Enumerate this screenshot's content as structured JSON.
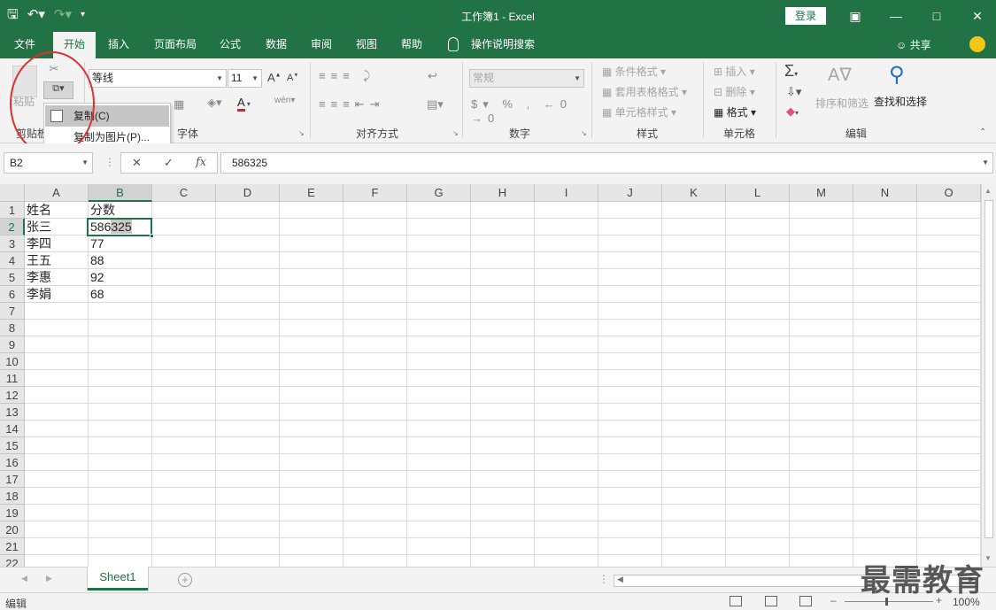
{
  "titlebar": {
    "title": "工作簿1  -  Excel",
    "login_label": "登录",
    "icons": [
      "save-icon",
      "undo-icon",
      "redo-icon",
      "customize-qat-icon",
      "ribbon-display-icon",
      "minimize-icon",
      "maximize-icon",
      "close-icon"
    ]
  },
  "tabs": {
    "items": [
      "文件",
      "开始",
      "插入",
      "页面布局",
      "公式",
      "数据",
      "审阅",
      "视图",
      "帮助"
    ],
    "active": "开始",
    "tell_me": "操作说明搜索",
    "share": "共享"
  },
  "ribbon": {
    "clipboard": {
      "label": "剪贴板",
      "paste": "粘贴"
    },
    "font": {
      "label": "字体",
      "font_name": "等线",
      "font_size": "11"
    },
    "alignment": {
      "label": "对齐方式"
    },
    "number": {
      "label": "数字",
      "format": "常规"
    },
    "styles": {
      "label": "样式",
      "conditional": "条件格式",
      "table": "套用表格格式",
      "cell_styles": "单元格样式"
    },
    "cells": {
      "label": "单元格",
      "insert": "插入",
      "delete": "删除",
      "format": "格式"
    },
    "editing": {
      "label": "编辑",
      "sort_filter": "排序和筛选",
      "find_select": "查找和选择"
    }
  },
  "copy_menu": {
    "items": [
      "复制(C)",
      "复制为图片(P)..."
    ],
    "highlighted": 0
  },
  "formula_bar": {
    "name_box": "B2",
    "value": "586325"
  },
  "sheet": {
    "columns": [
      "A",
      "B",
      "C",
      "D",
      "E",
      "F",
      "G",
      "H",
      "I",
      "J",
      "K",
      "L",
      "M",
      "N",
      "O"
    ],
    "selected_column": "B",
    "selected_row": 2,
    "rows": [
      {
        "num": "1",
        "A": "姓名",
        "B": "分数"
      },
      {
        "num": "2",
        "A": "张三",
        "B": "586325"
      },
      {
        "num": "3",
        "A": "李四",
        "B": "77"
      },
      {
        "num": "4",
        "A": "王五",
        "B": "88"
      },
      {
        "num": "5",
        "A": "李惠",
        "B": "92"
      },
      {
        "num": "6",
        "A": "李娟",
        "B": "68"
      },
      {
        "num": "7"
      },
      {
        "num": "8"
      },
      {
        "num": "9"
      },
      {
        "num": "10"
      },
      {
        "num": "11"
      },
      {
        "num": "12"
      },
      {
        "num": "13"
      },
      {
        "num": "14"
      },
      {
        "num": "15"
      },
      {
        "num": "16"
      },
      {
        "num": "17"
      },
      {
        "num": "18"
      },
      {
        "num": "19"
      },
      {
        "num": "20"
      },
      {
        "num": "21"
      },
      {
        "num": "22"
      }
    ],
    "tab_name": "Sheet1"
  },
  "status": {
    "mode": "编辑",
    "zoom": "100%"
  },
  "watermark": "最需教育",
  "colors": {
    "brand": "#217346",
    "annotation_circle": "#e03030"
  }
}
